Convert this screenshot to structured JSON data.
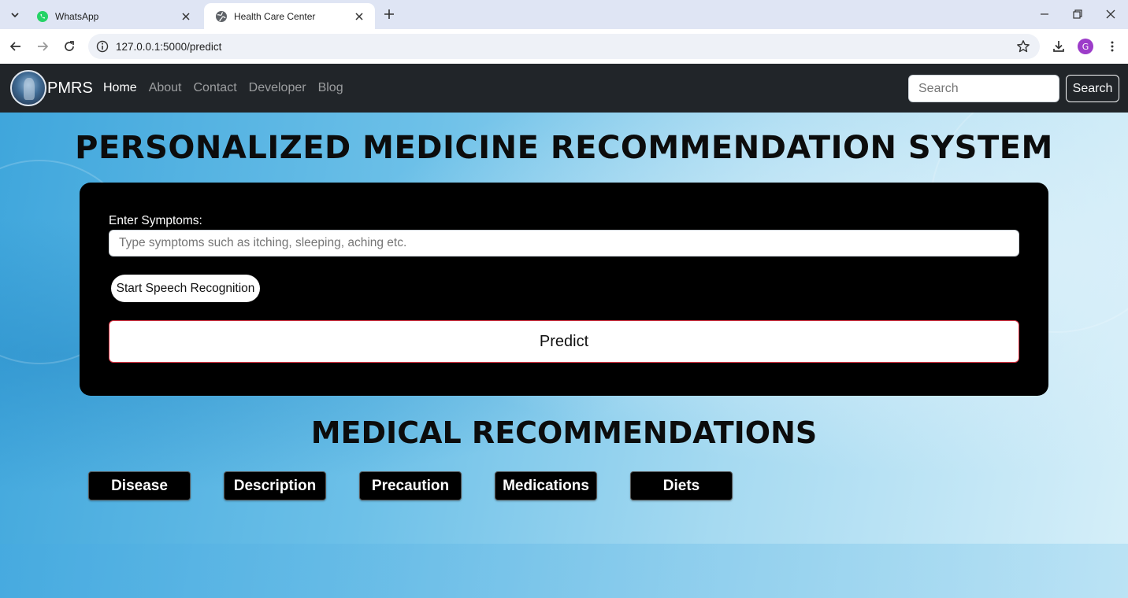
{
  "browser": {
    "tabs": [
      {
        "title": "WhatsApp",
        "active": false,
        "icon": "whatsapp-icon"
      },
      {
        "title": "Health Care Center",
        "active": true,
        "icon": "globe-icon"
      }
    ],
    "url": "127.0.0.1:5000/predict",
    "profile_initial": "G",
    "colors": {
      "tabstrip": "#dfe5f4",
      "profile": "#9c3cc9"
    }
  },
  "navbar": {
    "brand": "PMRS",
    "links": [
      {
        "label": "Home",
        "active": true
      },
      {
        "label": "About",
        "active": false
      },
      {
        "label": "Contact",
        "active": false
      },
      {
        "label": "Developer",
        "active": false
      },
      {
        "label": "Blog",
        "active": false
      }
    ],
    "search_placeholder": "Search",
    "search_button": "Search"
  },
  "main": {
    "title": "PERSONALIZED MEDICINE RECOMMENDATION SYSTEM",
    "form": {
      "label": "Enter Symptoms:",
      "placeholder": "Type symptoms such as itching, sleeping, aching etc.",
      "value": "",
      "speech_button": "Start Speech Recognition",
      "predict_button": "Predict"
    },
    "recommendations_title": "MEDICAL RECOMMENDATIONS",
    "recommendation_buttons": [
      "Disease",
      "Description",
      "Precaution",
      "Medications",
      "Diets"
    ]
  }
}
